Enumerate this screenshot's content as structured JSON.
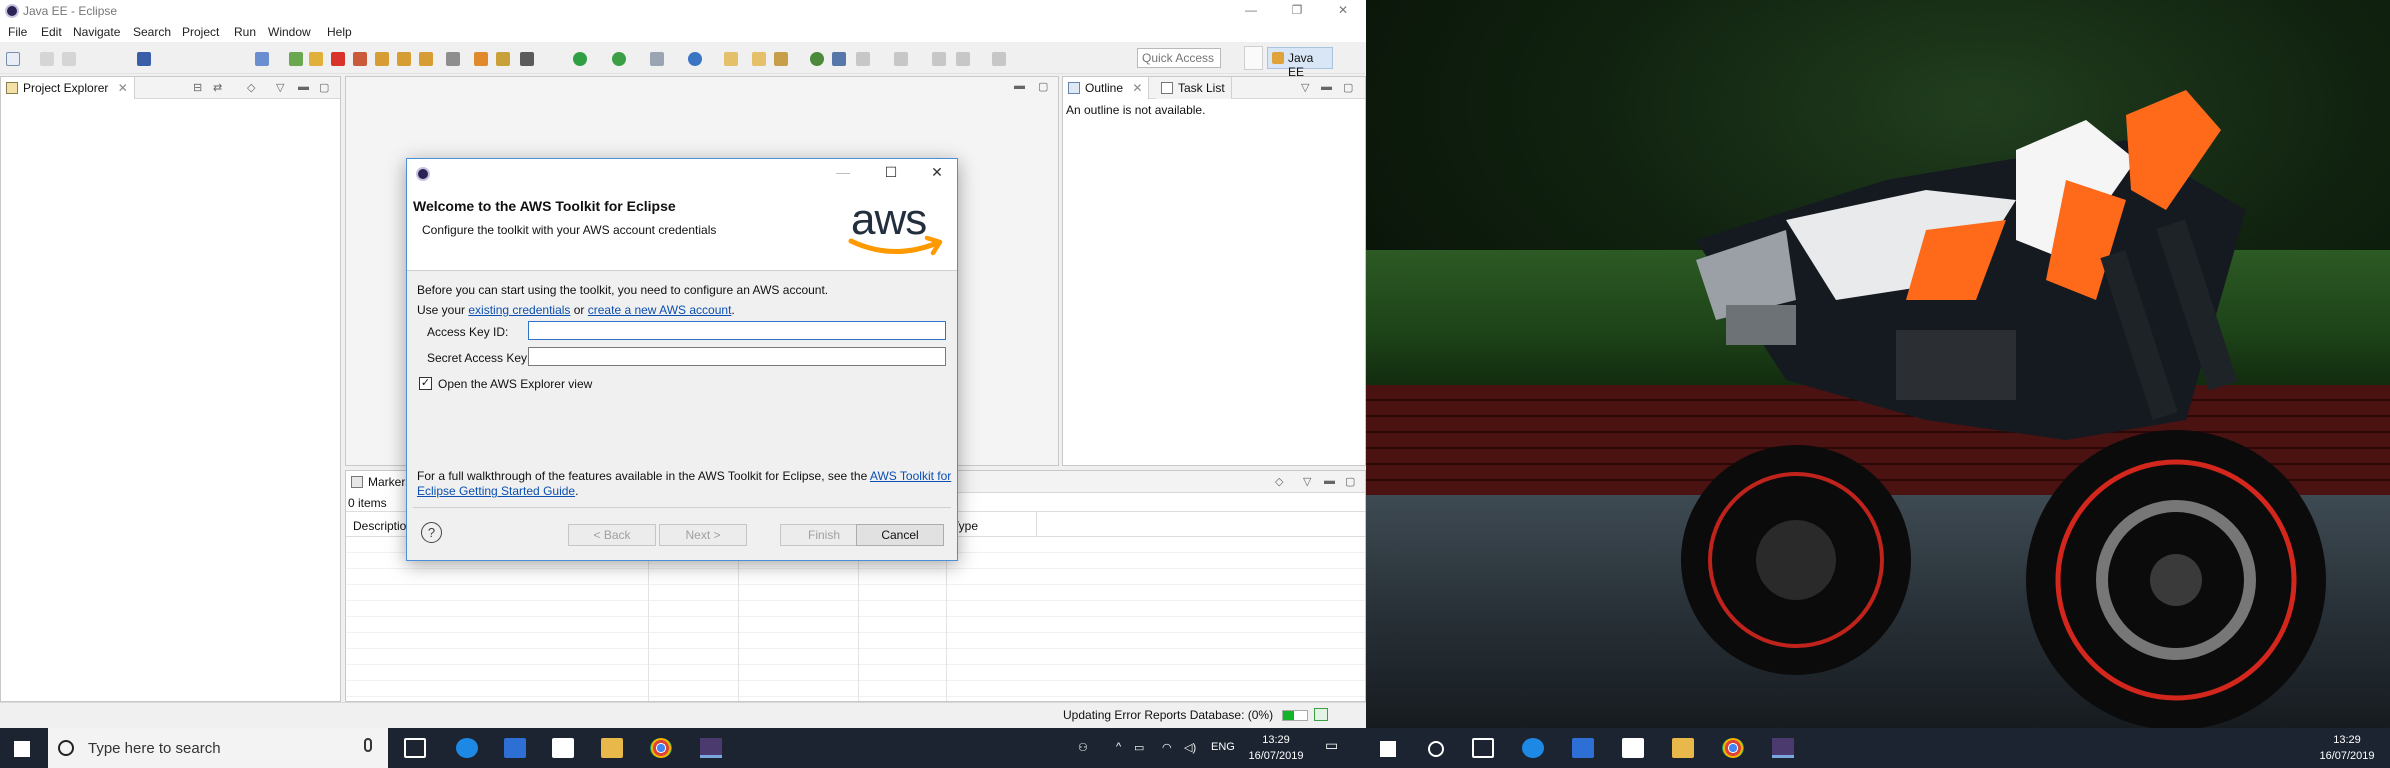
{
  "window": {
    "title": "Java EE - Eclipse",
    "controls": {
      "minimize": "—",
      "restore": "❐",
      "close": "✕"
    }
  },
  "menu": [
    "File",
    "Edit",
    "Navigate",
    "Search",
    "Project",
    "Run",
    "Window",
    "Help"
  ],
  "toolbar": {
    "quick_access_placeholder": "Quick Access",
    "perspective": "Java EE"
  },
  "views": {
    "project_explorer": {
      "title": "Project Explorer"
    },
    "outline": {
      "title": "Outline",
      "message": "An outline is not available."
    },
    "task_list": {
      "title": "Task List"
    },
    "markers": {
      "title": "Markers",
      "count": "0 items",
      "col_description": "Description",
      "col_type": "Type"
    }
  },
  "status": {
    "message": "Updating Error Reports Database: (0%)",
    "progress": 0.45
  },
  "dialog": {
    "title": "",
    "heading": "Welcome to the AWS Toolkit for Eclipse",
    "subheading": "Configure the toolkit with your AWS account credentials",
    "logo_text": "aws",
    "intro": "Before you can start using the toolkit, you need to configure an AWS account.",
    "use_prefix": "Use your ",
    "link_existing": "existing credentials",
    "or": " or ",
    "link_create": "create a new AWS account",
    "use_suffix": ".",
    "access_key_label": "Access Key ID:",
    "access_key_value": "",
    "secret_key_label": "Secret Access Key:",
    "secret_key_value": "",
    "checkbox_label": "Open the AWS Explorer view",
    "checkbox_checked": true,
    "walkthrough_prefix": "For a full walkthrough of the features available in the AWS Toolkit for Eclipse, see the ",
    "walkthrough_link": "AWS Toolkit for Eclipse Getting Started Guide",
    "walkthrough_suffix": ".",
    "help": "?",
    "back": "< Back",
    "next": "Next >",
    "finish": "Finish",
    "cancel": "Cancel"
  },
  "taskbar_left": {
    "search_placeholder": "Type here to search",
    "lang": "ENG",
    "time": "13:29",
    "date": "16/07/2019"
  },
  "taskbar_right": {
    "time": "13:29",
    "date": "16/07/2019"
  },
  "colors": {
    "accent": "#4a90d9",
    "taskbar": "#1b2430",
    "aws_orange": "#ff9900",
    "link": "#0b4fb0"
  }
}
